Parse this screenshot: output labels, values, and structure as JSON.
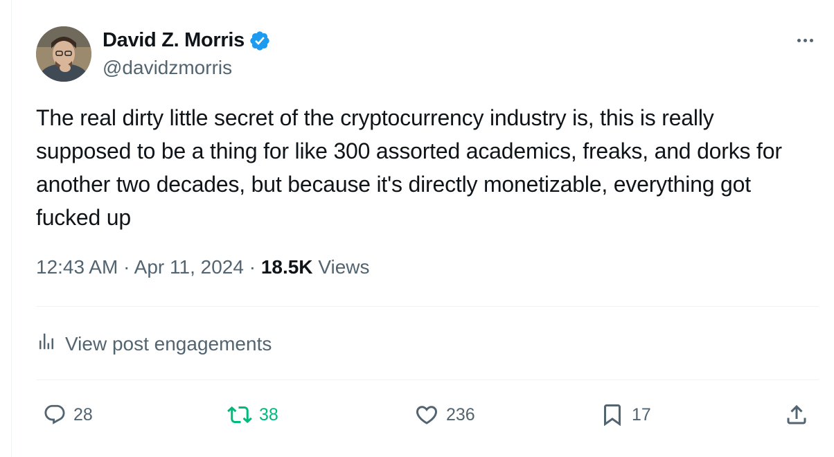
{
  "author": {
    "display_name": "David Z. Morris",
    "handle": "@davidzmorris",
    "verified": true
  },
  "post": {
    "text": "The real dirty little secret of the cryptocurrency industry is, this is really supposed to be a thing for like 300 assorted academics, freaks, and dorks for another two decades, but because it's directly monetizable, everything got fucked up",
    "time": "12:43 AM",
    "separator": "·",
    "date": "Apr 11, 2024",
    "views_count": "18.5K",
    "views_label": "Views"
  },
  "engagements": {
    "label": "View post engagements"
  },
  "actions": {
    "replies": "28",
    "reposts": "38",
    "likes": "236",
    "bookmarks": "17"
  },
  "colors": {
    "verified": "#1d9bf0",
    "repost_active": "#00ba7c",
    "secondary_text": "#536471"
  }
}
